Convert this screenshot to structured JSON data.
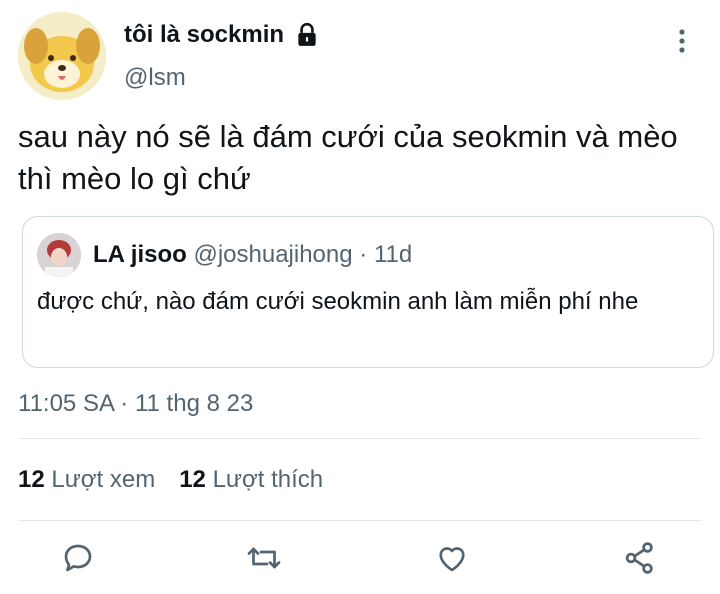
{
  "author": {
    "display_name": "tôi là sockmin",
    "handle": "@lsm",
    "avatar_icon": "dog-cartoon-avatar",
    "protected_icon": "lock-icon"
  },
  "menu_icon": "more-vertical-icon",
  "tweet": {
    "text": "sau này nó sẽ là đám cưới của seokmin và mèo thì mèo lo gì chứ"
  },
  "quote": {
    "display_name": "LA jisoo",
    "handle": "@joshuajihong",
    "separator": "·",
    "age": "11d",
    "text": "được chứ, nào đám cưới seokmin anh làm miễn phí nhe"
  },
  "timestamp": "11:05 SA · 11 thg 8 23",
  "stats": {
    "views_count": "12",
    "views_label": "Lượt xem",
    "likes_count": "12",
    "likes_label": "Lượt thích"
  },
  "actions": [
    "reply-icon",
    "retweet-icon",
    "like-icon",
    "share-icon"
  ],
  "colors": {
    "text": "#0f1419",
    "secondary": "#536471",
    "border": "#cfd9de",
    "divider": "#e5e8eb"
  }
}
